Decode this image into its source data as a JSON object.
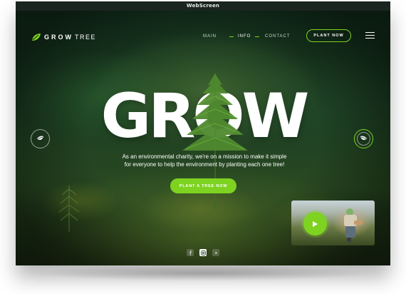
{
  "window": {
    "title": "WebScreen"
  },
  "brand": {
    "logo_strong": "GROW",
    "logo_light": "TREE",
    "accent_color": "#7ed321",
    "dark_bg": "#0f1d12"
  },
  "nav": {
    "items": [
      {
        "label": "MAIN"
      },
      {
        "label": "INFO",
        "active": true
      },
      {
        "label": "CONTACT"
      }
    ],
    "plant_button": "PLANT NOW",
    "menu_icon": "hamburger-icon"
  },
  "hero": {
    "headline": "GROW",
    "tagline_line1": "As an environmental charity, we're on a mission to make it simple",
    "tagline_line2": "for everyone to help the environment by planting each one tree!",
    "cta": "PLANT A TREE NOW",
    "prev_icon": "leaf-arrow-left-icon",
    "next_icon": "leaf-arrow-right-icon"
  },
  "video": {
    "play_icon": "play-icon"
  },
  "social": {
    "icons": [
      "facebook-icon",
      "instagram-icon",
      "youtube-icon"
    ]
  }
}
